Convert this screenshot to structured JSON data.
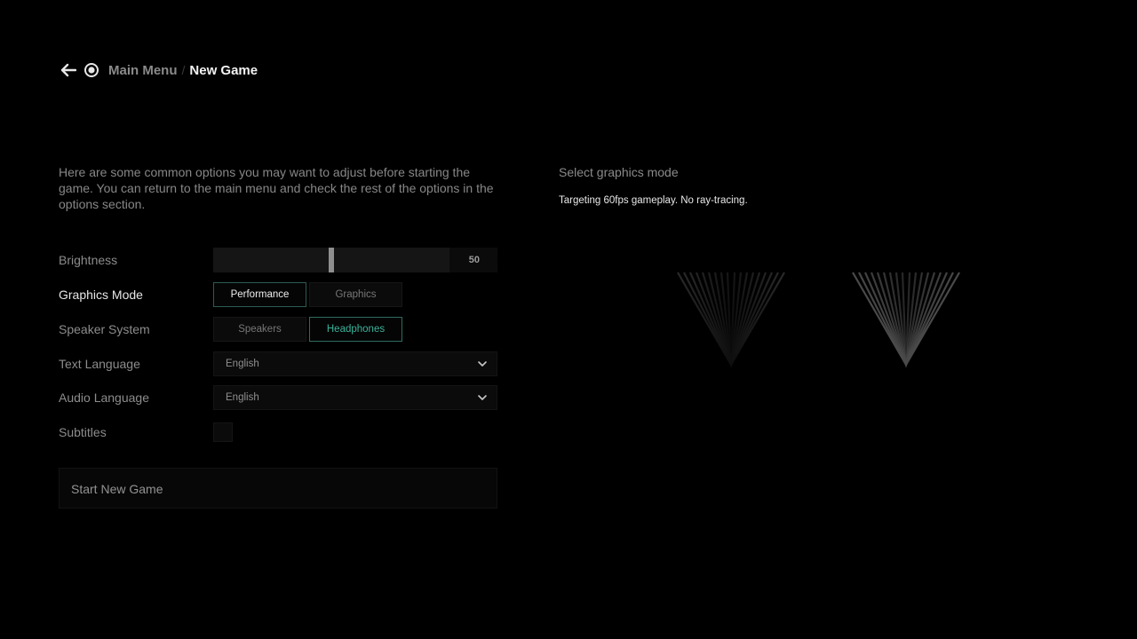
{
  "breadcrumb": {
    "back_icon": "arrow-left-icon",
    "home_icon": "ring-icon",
    "previous": "Main Menu",
    "separator": "/",
    "current": "New Game"
  },
  "intro_text": "Here are some common options you may want to adjust before starting the game. You can return to the main menu and check the rest of the options in the options section.",
  "settings": {
    "brightness": {
      "label": "Brightness",
      "value": 50,
      "value_text": "50",
      "min": 0,
      "max": 100
    },
    "graphics_mode": {
      "label": "Graphics Mode",
      "options": [
        "Performance",
        "Graphics"
      ],
      "selected": "Performance"
    },
    "speaker_system": {
      "label": "Speaker System",
      "options": [
        "Speakers",
        "Headphones"
      ],
      "selected": "Headphones"
    },
    "text_language": {
      "label": "Text Language",
      "value": "English",
      "chevron_icon": "chevron-down-icon"
    },
    "audio_language": {
      "label": "Audio Language",
      "value": "English",
      "chevron_icon": "chevron-down-icon"
    },
    "subtitles": {
      "label": "Subtitles",
      "checked": false
    }
  },
  "start_button": {
    "label": "Start New Game"
  },
  "info_panel": {
    "title": "Select graphics mode",
    "description": "Targeting 60fps gameplay. No ray-tracing.",
    "icons": [
      "performance-triangle-icon",
      "graphics-triangle-icon"
    ]
  },
  "colors": {
    "background": "#000000",
    "accent_green": "#3bb39a",
    "selected_border": "#2c5c52",
    "text_primary": "#e8e8e8",
    "text_secondary": "#8c8c8c"
  }
}
